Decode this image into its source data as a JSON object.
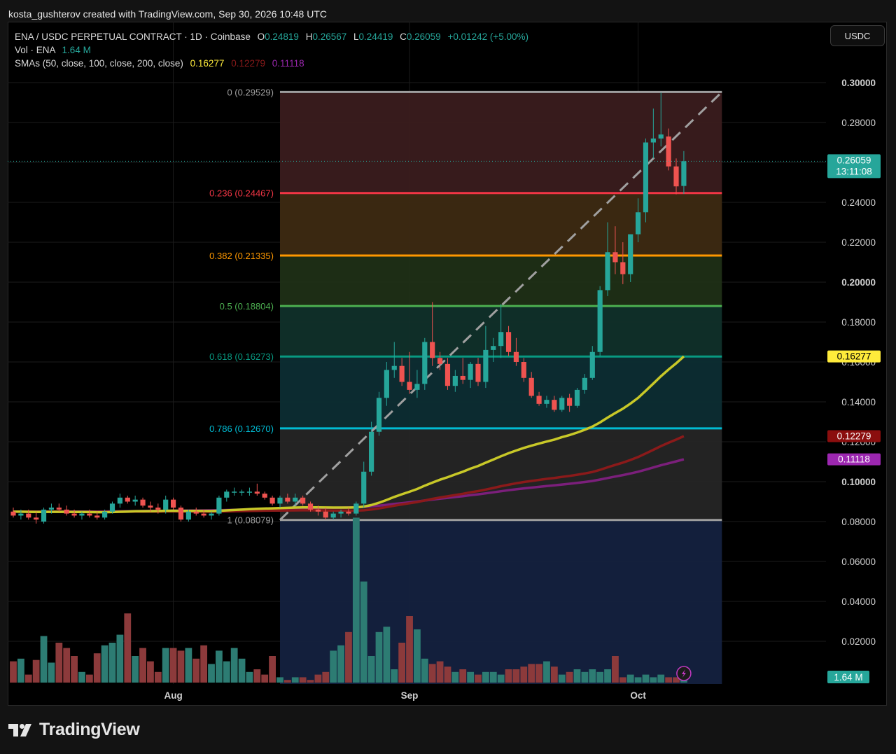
{
  "header": {
    "caption": "kosta_gushterov created with TradingView.com, Sep 30, 2026 10:48 UTC"
  },
  "legend": {
    "symbol": "ENA / USDC PERPETUAL CONTRACT · 1D · Coinbase",
    "o_label": "O",
    "o_value": "0.24819",
    "h_label": "H",
    "h_value": "0.26567",
    "l_label": "L",
    "l_value": "0.24419",
    "c_label": "C",
    "c_value": "0.26059",
    "change": "+0.01242 (+5.00%)",
    "vol_label": "Vol · ENA",
    "vol_value": "1.64 M",
    "sma_label": "SMAs (50, close, 100, close, 200, close)",
    "sma50": "0.16277",
    "sma100": "0.12279",
    "sma200": "0.11118"
  },
  "quote_button": "USDC",
  "brand": "TradingView",
  "colors": {
    "up": "#26a69a",
    "down": "#ef5350",
    "sma50": "#c8c828",
    "sma100": "#8b1a1a",
    "sma200": "#7b1f7b",
    "price_badge": "#26a69a",
    "sma50_badge": "#ffeb3b",
    "sma100_badge": "#8b0e0e",
    "sma200_badge": "#9c27b0"
  },
  "chart_data": {
    "type": "candlestick",
    "price_axis": {
      "ylim": [
        0.0,
        0.3
      ],
      "ticks": [
        "0.30000",
        "0.28000",
        "0.26000",
        "0.24000",
        "0.22000",
        "0.20000",
        "0.18000",
        "0.16000",
        "0.14000",
        "0.12000",
        "0.10000",
        "0.08000",
        "0.06000",
        "0.04000",
        "0.02000"
      ]
    },
    "time_axis": {
      "labels": [
        "Aug",
        "Sep",
        "Oct"
      ],
      "label_dates": [
        "2026-08-01",
        "2026-09-01",
        "2026-10-01"
      ],
      "first_date": "2026-07-11",
      "last_date": "2026-09-30"
    },
    "current_price": {
      "value": "0.26059",
      "countdown": "13:11:08"
    },
    "sma_badges": {
      "sma50": "0.16277",
      "sma100": "0.12279",
      "sma200": "0.11118"
    },
    "volume_badge": "1.64 M",
    "fib": {
      "from_date": "2026-08-15",
      "to_date": "2026-10-12",
      "levels": [
        {
          "ratio": "0",
          "price": 0.29529,
          "label": "0 (0.29529)",
          "color": "#9e9e9e",
          "fill": "#3a1c1e"
        },
        {
          "ratio": "0.236",
          "price": 0.24467,
          "label": "0.236 (0.24467)",
          "color": "#f23645",
          "fill": "#3d2a12"
        },
        {
          "ratio": "0.382",
          "price": 0.21335,
          "label": "0.382 (0.21335)",
          "color": "#ff9800",
          "fill": "#1f2f16"
        },
        {
          "ratio": "0.5",
          "price": 0.18804,
          "label": "0.5 (0.18804)",
          "color": "#4caf50",
          "fill": "#10302a"
        },
        {
          "ratio": "0.618",
          "price": 0.16273,
          "label": "0.618 (0.16273)",
          "color": "#089981",
          "fill": "#0d2d33"
        },
        {
          "ratio": "0.786",
          "price": 0.1267,
          "label": "0.786 (0.12670)",
          "color": "#00bcd4",
          "fill": "#252525"
        },
        {
          "ratio": "1",
          "price": 0.08079,
          "label": "1 (0.08079)",
          "color": "#9e9e9e",
          "fill": "#14213f"
        }
      ],
      "lower_fill_to": 0.0,
      "trend_line": {
        "from_date": "2026-08-15",
        "from_price": 0.0808,
        "to_date": "2026-10-12",
        "to_price": 0.2953
      }
    },
    "candles": [
      {
        "d": "2026-07-11",
        "o": 0.085,
        "h": 0.087,
        "l": 0.082,
        "c": 0.083
      },
      {
        "d": "2026-07-12",
        "o": 0.083,
        "h": 0.086,
        "l": 0.081,
        "c": 0.084
      },
      {
        "d": "2026-07-13",
        "o": 0.084,
        "h": 0.086,
        "l": 0.081,
        "c": 0.082
      },
      {
        "d": "2026-07-14",
        "o": 0.082,
        "h": 0.085,
        "l": 0.079,
        "c": 0.081
      },
      {
        "d": "2026-07-15",
        "o": 0.08,
        "h": 0.087,
        "l": 0.079,
        "c": 0.086
      },
      {
        "d": "2026-07-16",
        "o": 0.086,
        "h": 0.089,
        "l": 0.084,
        "c": 0.087
      },
      {
        "d": "2026-07-17",
        "o": 0.087,
        "h": 0.089,
        "l": 0.085,
        "c": 0.086
      },
      {
        "d": "2026-07-18",
        "o": 0.086,
        "h": 0.088,
        "l": 0.083,
        "c": 0.084
      },
      {
        "d": "2026-07-19",
        "o": 0.084,
        "h": 0.086,
        "l": 0.082,
        "c": 0.083
      },
      {
        "d": "2026-07-20",
        "o": 0.083,
        "h": 0.085,
        "l": 0.081,
        "c": 0.084
      },
      {
        "d": "2026-07-21",
        "o": 0.084,
        "h": 0.086,
        "l": 0.082,
        "c": 0.083
      },
      {
        "d": "2026-07-22",
        "o": 0.083,
        "h": 0.085,
        "l": 0.081,
        "c": 0.082
      },
      {
        "d": "2026-07-23",
        "o": 0.082,
        "h": 0.086,
        "l": 0.081,
        "c": 0.085
      },
      {
        "d": "2026-07-24",
        "o": 0.085,
        "h": 0.09,
        "l": 0.084,
        "c": 0.089
      },
      {
        "d": "2026-07-25",
        "o": 0.089,
        "h": 0.094,
        "l": 0.087,
        "c": 0.092
      },
      {
        "d": "2026-07-26",
        "o": 0.092,
        "h": 0.093,
        "l": 0.089,
        "c": 0.09
      },
      {
        "d": "2026-07-27",
        "o": 0.09,
        "h": 0.093,
        "l": 0.088,
        "c": 0.091
      },
      {
        "d": "2026-07-28",
        "o": 0.091,
        "h": 0.092,
        "l": 0.087,
        "c": 0.088
      },
      {
        "d": "2026-07-29",
        "o": 0.088,
        "h": 0.09,
        "l": 0.085,
        "c": 0.087
      },
      {
        "d": "2026-07-30",
        "o": 0.087,
        "h": 0.089,
        "l": 0.084,
        "c": 0.086
      },
      {
        "d": "2026-07-31",
        "o": 0.086,
        "h": 0.093,
        "l": 0.084,
        "c": 0.091
      },
      {
        "d": "2026-08-01",
        "o": 0.091,
        "h": 0.092,
        "l": 0.086,
        "c": 0.087
      },
      {
        "d": "2026-08-02",
        "o": 0.087,
        "h": 0.088,
        "l": 0.08,
        "c": 0.081
      },
      {
        "d": "2026-08-03",
        "o": 0.081,
        "h": 0.086,
        "l": 0.08,
        "c": 0.085
      },
      {
        "d": "2026-08-04",
        "o": 0.085,
        "h": 0.087,
        "l": 0.083,
        "c": 0.084
      },
      {
        "d": "2026-08-05",
        "o": 0.084,
        "h": 0.086,
        "l": 0.082,
        "c": 0.083
      },
      {
        "d": "2026-08-06",
        "o": 0.083,
        "h": 0.085,
        "l": 0.081,
        "c": 0.084
      },
      {
        "d": "2026-08-07",
        "o": 0.084,
        "h": 0.093,
        "l": 0.083,
        "c": 0.092
      },
      {
        "d": "2026-08-08",
        "o": 0.092,
        "h": 0.096,
        "l": 0.09,
        "c": 0.095
      },
      {
        "d": "2026-08-09",
        "o": 0.095,
        "h": 0.097,
        "l": 0.093,
        "c": 0.095
      },
      {
        "d": "2026-08-10",
        "o": 0.095,
        "h": 0.096,
        "l": 0.093,
        "c": 0.095
      },
      {
        "d": "2026-08-11",
        "o": 0.095,
        "h": 0.097,
        "l": 0.093,
        "c": 0.095
      },
      {
        "d": "2026-08-12",
        "o": 0.095,
        "h": 0.099,
        "l": 0.093,
        "c": 0.094
      },
      {
        "d": "2026-08-13",
        "o": 0.094,
        "h": 0.095,
        "l": 0.091,
        "c": 0.092
      },
      {
        "d": "2026-08-14",
        "o": 0.092,
        "h": 0.093,
        "l": 0.088,
        "c": 0.089
      },
      {
        "d": "2026-08-15",
        "o": 0.089,
        "h": 0.093,
        "l": 0.087,
        "c": 0.092
      },
      {
        "d": "2026-08-16",
        "o": 0.092,
        "h": 0.094,
        "l": 0.089,
        "c": 0.09
      },
      {
        "d": "2026-08-17",
        "o": 0.09,
        "h": 0.094,
        "l": 0.088,
        "c": 0.092
      },
      {
        "d": "2026-08-18",
        "o": 0.092,
        "h": 0.093,
        "l": 0.088,
        "c": 0.089
      },
      {
        "d": "2026-08-19",
        "o": 0.089,
        "h": 0.09,
        "l": 0.085,
        "c": 0.086
      },
      {
        "d": "2026-08-20",
        "o": 0.086,
        "h": 0.088,
        "l": 0.083,
        "c": 0.085
      },
      {
        "d": "2026-08-21",
        "o": 0.085,
        "h": 0.087,
        "l": 0.081,
        "c": 0.082
      },
      {
        "d": "2026-08-22",
        "o": 0.082,
        "h": 0.085,
        "l": 0.081,
        "c": 0.084
      },
      {
        "d": "2026-08-23",
        "o": 0.084,
        "h": 0.086,
        "l": 0.082,
        "c": 0.085
      },
      {
        "d": "2026-08-24",
        "o": 0.085,
        "h": 0.087,
        "l": 0.083,
        "c": 0.084
      },
      {
        "d": "2026-08-25",
        "o": 0.084,
        "h": 0.09,
        "l": 0.083,
        "c": 0.089
      },
      {
        "d": "2026-08-26",
        "o": 0.089,
        "h": 0.11,
        "l": 0.087,
        "c": 0.105
      },
      {
        "d": "2026-08-27",
        "o": 0.105,
        "h": 0.13,
        "l": 0.103,
        "c": 0.125
      },
      {
        "d": "2026-08-28",
        "o": 0.125,
        "h": 0.145,
        "l": 0.123,
        "c": 0.142
      },
      {
        "d": "2026-08-29",
        "o": 0.142,
        "h": 0.16,
        "l": 0.138,
        "c": 0.156
      },
      {
        "d": "2026-08-30",
        "o": 0.156,
        "h": 0.17,
        "l": 0.152,
        "c": 0.158
      },
      {
        "d": "2026-08-31",
        "o": 0.158,
        "h": 0.162,
        "l": 0.148,
        "c": 0.15
      },
      {
        "d": "2026-09-01",
        "o": 0.15,
        "h": 0.165,
        "l": 0.144,
        "c": 0.146
      },
      {
        "d": "2026-09-02",
        "o": 0.146,
        "h": 0.156,
        "l": 0.142,
        "c": 0.149
      },
      {
        "d": "2026-09-03",
        "o": 0.149,
        "h": 0.172,
        "l": 0.146,
        "c": 0.17
      },
      {
        "d": "2026-09-04",
        "o": 0.17,
        "h": 0.19,
        "l": 0.158,
        "c": 0.162
      },
      {
        "d": "2026-09-05",
        "o": 0.162,
        "h": 0.165,
        "l": 0.156,
        "c": 0.159
      },
      {
        "d": "2026-09-06",
        "o": 0.159,
        "h": 0.162,
        "l": 0.146,
        "c": 0.148
      },
      {
        "d": "2026-09-07",
        "o": 0.148,
        "h": 0.156,
        "l": 0.145,
        "c": 0.153
      },
      {
        "d": "2026-09-08",
        "o": 0.153,
        "h": 0.162,
        "l": 0.149,
        "c": 0.151
      },
      {
        "d": "2026-09-09",
        "o": 0.151,
        "h": 0.16,
        "l": 0.147,
        "c": 0.159
      },
      {
        "d": "2026-09-10",
        "o": 0.159,
        "h": 0.162,
        "l": 0.148,
        "c": 0.15
      },
      {
        "d": "2026-09-11",
        "o": 0.15,
        "h": 0.178,
        "l": 0.147,
        "c": 0.166
      },
      {
        "d": "2026-09-12",
        "o": 0.166,
        "h": 0.172,
        "l": 0.16,
        "c": 0.168
      },
      {
        "d": "2026-09-13",
        "o": 0.168,
        "h": 0.189,
        "l": 0.162,
        "c": 0.175
      },
      {
        "d": "2026-09-14",
        "o": 0.175,
        "h": 0.178,
        "l": 0.163,
        "c": 0.165
      },
      {
        "d": "2026-09-15",
        "o": 0.165,
        "h": 0.172,
        "l": 0.158,
        "c": 0.16
      },
      {
        "d": "2026-09-16",
        "o": 0.16,
        "h": 0.162,
        "l": 0.15,
        "c": 0.152
      },
      {
        "d": "2026-09-17",
        "o": 0.152,
        "h": 0.155,
        "l": 0.142,
        "c": 0.143
      },
      {
        "d": "2026-09-18",
        "o": 0.143,
        "h": 0.145,
        "l": 0.138,
        "c": 0.139
      },
      {
        "d": "2026-09-19",
        "o": 0.139,
        "h": 0.143,
        "l": 0.137,
        "c": 0.141
      },
      {
        "d": "2026-09-20",
        "o": 0.141,
        "h": 0.143,
        "l": 0.135,
        "c": 0.136
      },
      {
        "d": "2026-09-21",
        "o": 0.136,
        "h": 0.143,
        "l": 0.135,
        "c": 0.142
      },
      {
        "d": "2026-09-22",
        "o": 0.142,
        "h": 0.144,
        "l": 0.135,
        "c": 0.138
      },
      {
        "d": "2026-09-23",
        "o": 0.138,
        "h": 0.147,
        "l": 0.137,
        "c": 0.146
      },
      {
        "d": "2026-09-24",
        "o": 0.146,
        "h": 0.154,
        "l": 0.144,
        "c": 0.152
      },
      {
        "d": "2026-09-25",
        "o": 0.152,
        "h": 0.168,
        "l": 0.151,
        "c": 0.165
      },
      {
        "d": "2026-09-26",
        "o": 0.165,
        "h": 0.198,
        "l": 0.163,
        "c": 0.196
      },
      {
        "d": "2026-09-27",
        "o": 0.196,
        "h": 0.23,
        "l": 0.193,
        "c": 0.215
      },
      {
        "d": "2026-09-28",
        "o": 0.215,
        "h": 0.228,
        "l": 0.204,
        "c": 0.21
      },
      {
        "d": "2026-09-29",
        "o": 0.21,
        "h": 0.22,
        "l": 0.199,
        "c": 0.204
      },
      {
        "d": "2026-09-30",
        "o": 0.204,
        "h": 0.224,
        "l": 0.2,
        "c": 0.224
      }
    ],
    "candles_tail": [
      {
        "d": "2026-10-01",
        "o": 0.224,
        "h": 0.242,
        "l": 0.22,
        "c": 0.235
      },
      {
        "d": "2026-10-02",
        "o": 0.235,
        "h": 0.272,
        "l": 0.23,
        "c": 0.27
      },
      {
        "d": "2026-10-03",
        "o": 0.27,
        "h": 0.287,
        "l": 0.262,
        "c": 0.272
      },
      {
        "d": "2026-10-04",
        "o": 0.272,
        "h": 0.295,
        "l": 0.268,
        "c": 0.274
      },
      {
        "d": "2026-10-05",
        "o": 0.273,
        "h": 0.277,
        "l": 0.256,
        "c": 0.258
      },
      {
        "d": "2026-10-06",
        "o": 0.258,
        "h": 0.262,
        "l": 0.244,
        "c": 0.248
      },
      {
        "d": "2026-10-07",
        "o": 0.2482,
        "h": 0.2657,
        "l": 0.2442,
        "c": 0.2606
      }
    ],
    "volume_ratio_series": [
      0.8,
      0.9,
      0.3,
      0.85,
      1.75,
      0.75,
      1.5,
      1.3,
      1.0,
      0.4,
      0.3,
      1.1,
      1.4,
      1.5,
      1.8,
      2.6,
      1.0,
      1.3,
      0.8,
      0.4,
      1.3,
      1.3,
      1.2,
      1.3,
      0.9,
      1.4,
      0.7,
      1.2,
      0.8,
      1.3,
      0.9,
      0.4,
      0.5,
      0.3,
      1.0,
      0.2,
      0.1,
      0.2,
      0.2,
      0.1,
      0.3,
      0.4,
      1.2,
      1.4,
      1.9,
      6.2,
      3.8,
      1.0,
      1.9,
      2.1,
      0.5,
      1.5,
      2.5,
      2.0,
      0.9,
      0.7,
      0.8,
      0.6,
      0.4,
      0.5,
      0.4,
      0.3,
      0.4,
      0.4,
      0.3,
      0.5,
      0.5,
      0.6,
      0.7,
      0.7,
      0.8,
      0.6,
      0.3,
      0.4,
      0.5,
      0.4,
      0.5,
      0.4,
      0.5,
      1.0,
      0.2,
      0.3,
      0.2,
      0.3,
      0.2,
      0.3,
      0.2,
      0.2
    ]
  }
}
